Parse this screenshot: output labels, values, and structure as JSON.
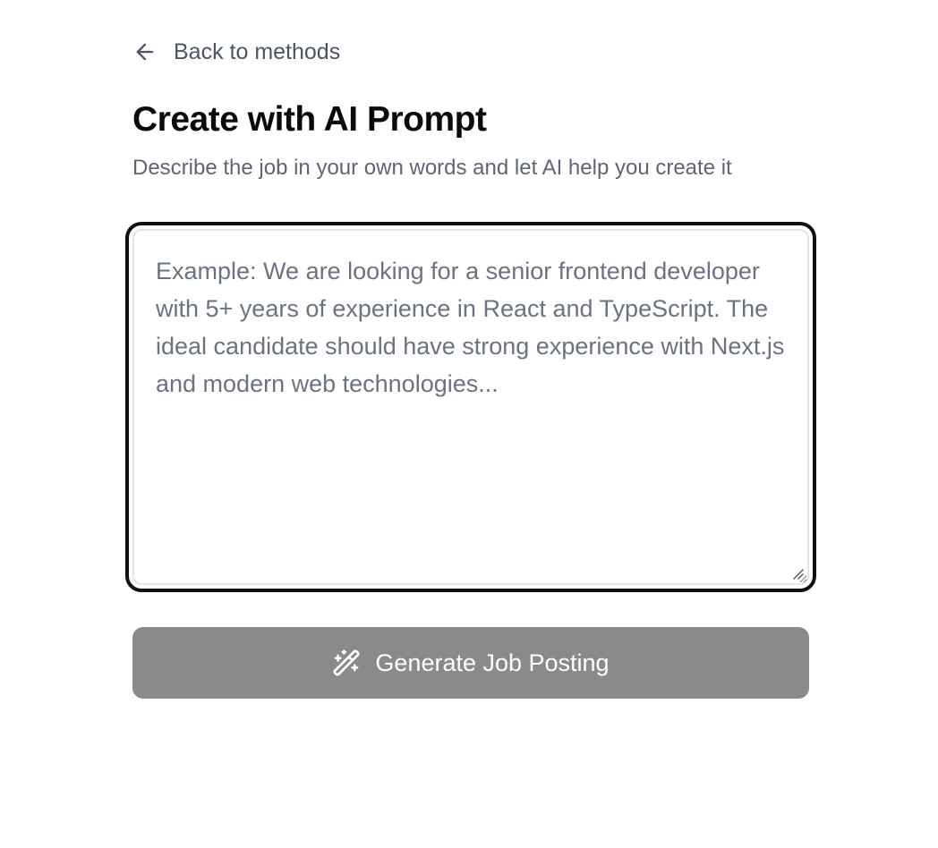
{
  "nav": {
    "back_label": "Back to methods",
    "back_icon": "arrow-left-icon"
  },
  "header": {
    "title": "Create with AI Prompt",
    "subtitle": "Describe the job in your own words and let AI help you create it"
  },
  "prompt": {
    "value": "",
    "placeholder": "Example: We are looking for a senior frontend developer with 5+ years of experience in React and TypeScript. The ideal candidate should have strong experience with Next.js and modern web technologies...",
    "focused": true
  },
  "action": {
    "generate_label": "Generate Job Posting",
    "generate_icon": "magic-wand-icon",
    "disabled": true
  },
  "colors": {
    "button_disabled_bg": "#8a8a8c",
    "focus_border": "#111111",
    "muted_text": "#5f6672"
  }
}
